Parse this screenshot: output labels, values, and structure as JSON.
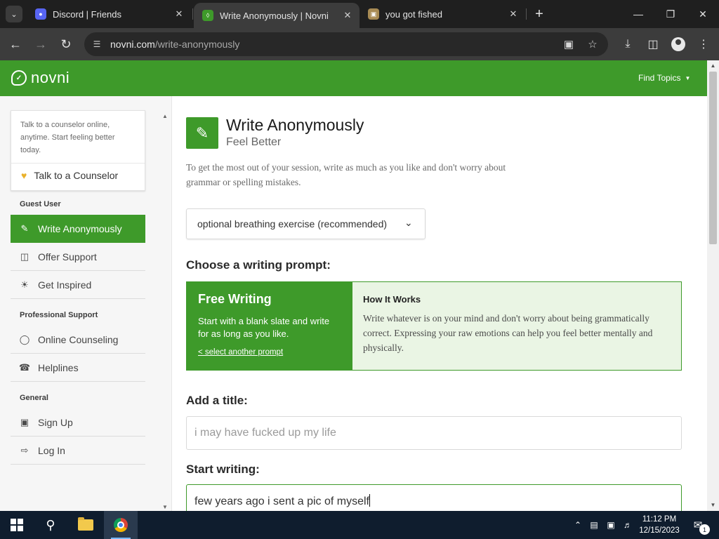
{
  "browser": {
    "tabs": [
      {
        "title": "Discord | Friends",
        "favicon": "discord-icon",
        "color": "#5865f2"
      },
      {
        "title": "Write Anonymously | Novni",
        "favicon": "novni-icon",
        "color": "#3e9a2a"
      },
      {
        "title": "you got fished",
        "favicon": "image-icon",
        "color": "#a88b54"
      }
    ],
    "url_host": "novni.com",
    "url_path": "/write-anonymously"
  },
  "site": {
    "logo": "novni",
    "find_topics": "Find Topics",
    "brand_color": "#3e9a2a"
  },
  "sidebar": {
    "cta_text": "Talk to a counselor online, anytime. Start feeling better today.",
    "cta_button": "Talk to a Counselor",
    "sections": [
      {
        "heading": "Guest User",
        "items": [
          "Write Anonymously",
          "Offer Support",
          "Get Inspired"
        ]
      },
      {
        "heading": "Professional Support",
        "items": [
          "Online Counseling",
          "Helplines"
        ]
      },
      {
        "heading": "General",
        "items": [
          "Sign Up",
          "Log In"
        ]
      }
    ],
    "active_item": "Write Anonymously"
  },
  "main": {
    "title": "Write Anonymously",
    "subtitle": "Feel Better",
    "intro": "To get the most out of your session, write as much as you like and don't worry about grammar or spelling mistakes.",
    "dropdown": "optional breathing exercise (recommended)",
    "prompt_heading": "Choose a writing prompt:",
    "prompt": {
      "name": "Free Writing",
      "description": "Start with a blank slate and write for as long as you like.",
      "link": "< select another prompt",
      "how_title": "How It Works",
      "how_text": "Write whatever is on your mind and don't worry about being grammatically correct. Expressing your raw emotions can help you feel better mentally and physically."
    },
    "title_heading": "Add a title:",
    "title_value": "i may have fucked up my life",
    "writing_heading": "Start writing:",
    "writing_value": "few years ago i sent a pic of myself"
  },
  "taskbar": {
    "time": "11:12 PM",
    "date": "12/15/2023",
    "notification_count": "1"
  }
}
